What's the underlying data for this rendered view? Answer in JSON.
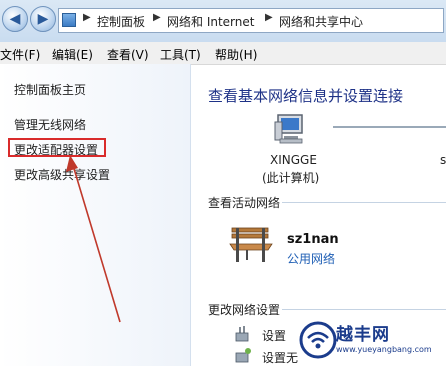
{
  "address_bar": {
    "segments": [
      "控制面板",
      "网络和 Internet",
      "网络和共享中心"
    ]
  },
  "menu": {
    "items": [
      "文件(F)",
      "编辑(E)",
      "查看(V)",
      "工具(T)",
      "帮助(H)"
    ]
  },
  "sidebar": {
    "items": [
      "控制面板主页",
      "管理无线网络",
      "更改适配器设置",
      "更改高级共享设置"
    ],
    "highlighted_index": 2
  },
  "main": {
    "title": "查看基本网络信息并设置连接",
    "computer_name": "XINGGE",
    "computer_subtitle": "(此计算机)",
    "clipped_label": "s",
    "active_networks_heading": "查看活动网络",
    "network_name": "sz1nan",
    "network_type": "公用网络",
    "change_settings_heading": "更改网络设置",
    "setting_1": "设置",
    "setting_2": "设置无"
  },
  "watermark": {
    "text": "越丰网",
    "url": "www.yueyangbang.com"
  },
  "colors": {
    "highlight_box": "#d92b2b",
    "arrow": "#c0392b",
    "title": "#1e3287",
    "link": "#1f5fb5"
  }
}
